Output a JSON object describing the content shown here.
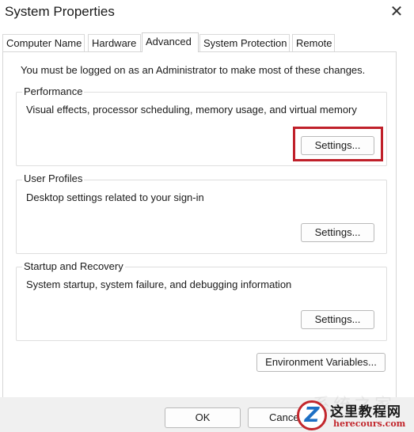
{
  "window": {
    "title": "System Properties",
    "close_glyph": "✕"
  },
  "tabs": [
    {
      "label": "Computer Name",
      "active": false
    },
    {
      "label": "Hardware",
      "active": false
    },
    {
      "label": "Advanced",
      "active": true
    },
    {
      "label": "System Protection",
      "active": false
    },
    {
      "label": "Remote",
      "active": false
    }
  ],
  "admin_note": "You must be logged on as an Administrator to make most of these changes.",
  "performance": {
    "label": "Performance",
    "description": "Visual effects, processor scheduling, memory usage, and virtual memory",
    "button": "Settings...",
    "highlight_color": "#c0202a"
  },
  "user_profiles": {
    "label": "User Profiles",
    "description": "Desktop settings related to your sign-in",
    "button": "Settings..."
  },
  "startup_recovery": {
    "label": "Startup and Recovery",
    "description": "System startup, system failure, and debugging information",
    "button": "Settings..."
  },
  "environment_button": "Environment Variables...",
  "footer": {
    "ok": "OK",
    "cancel": "Cance"
  },
  "watermark": {
    "logo_letter": "Z",
    "name": "这里教程网",
    "url": "herecours.com",
    "faint_text": "系统之家"
  }
}
